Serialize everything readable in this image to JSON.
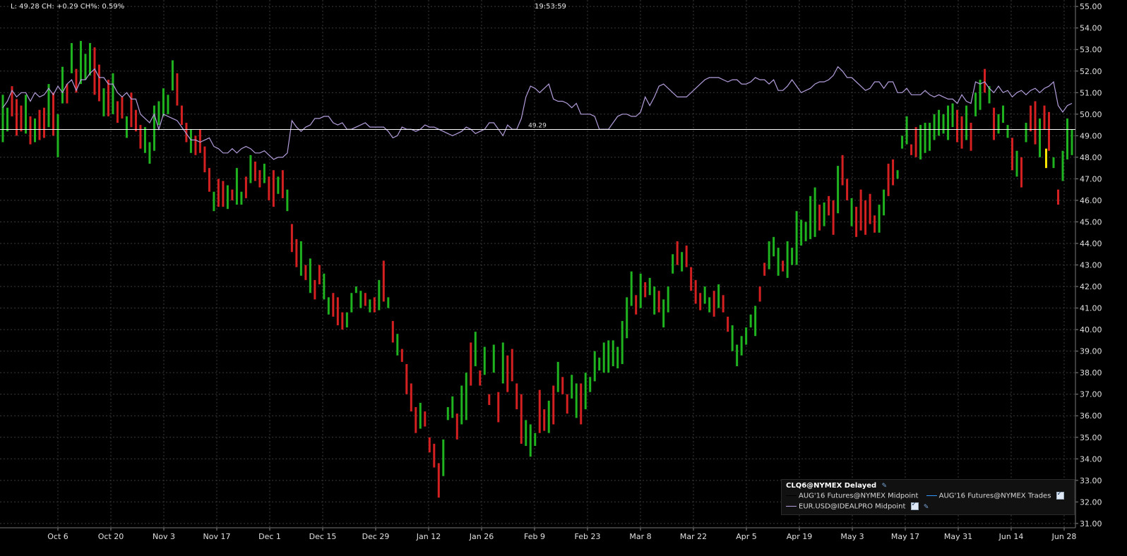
{
  "header": {
    "stats": "L: 49.28 CH: +0.29 CH%: 0.59%",
    "time": "19:53:59"
  },
  "legend": {
    "title": "CLQ6@NYMEX Delayed",
    "items": [
      {
        "label": "AUG'16 Futures@NYMEX Midpoint",
        "color": "#000000"
      },
      {
        "label": "AUG'16 Futures@NYMEX Trades",
        "color": "#3399ff"
      },
      {
        "label": "EUR.USD@IDEALPRO Midpoint",
        "color": "#b39ddb"
      }
    ]
  },
  "chart_data": {
    "type": "bar",
    "ylim": [
      30.8,
      55.3
    ],
    "yticks": [
      "31.00",
      "32.00",
      "33.00",
      "34.00",
      "35.00",
      "36.00",
      "37.00",
      "38.00",
      "39.00",
      "40.00",
      "41.00",
      "42.00",
      "43.00",
      "44.00",
      "45.00",
      "46.00",
      "47.00",
      "48.00",
      "49.00",
      "50.00",
      "51.00",
      "52.00",
      "53.00",
      "54.00",
      "55.00"
    ],
    "xticks": [
      "Oct 6",
      "Oct 20",
      "Nov 3",
      "Nov 17",
      "Dec 1",
      "Dec 15",
      "Dec 29",
      "Jan 12",
      "Jan 26",
      "Feb 9",
      "Feb 23",
      "Mar 8",
      "Mar 22",
      "Apr 5",
      "Apr 19",
      "May 3",
      "May 17",
      "May 31",
      "Jun 14",
      "Jun 28"
    ],
    "last_price_line": {
      "value": 49.29,
      "label": "49.29",
      "color": "#ffffff"
    },
    "colors": {
      "up": "#1fb31f",
      "down": "#d42020",
      "current": "#ffe400",
      "eurusd": "#b39ddb",
      "grid": "#3a3a3a"
    },
    "ohlc_bars": [
      [
        50.9,
        48.7
      ],
      [
        50.3,
        49.2
      ],
      [
        51.3,
        49.9
      ],
      [
        50.7,
        49.0
      ],
      [
        50.4,
        49.2
      ],
      [
        50.9,
        49.1
      ],
      [
        49.9,
        48.6
      ],
      [
        49.8,
        48.7
      ],
      [
        50.2,
        48.8
      ],
      [
        50.3,
        48.9
      ],
      [
        51.4,
        49.4
      ],
      [
        51.0,
        49.0
      ],
      [
        50.0,
        48.0
      ],
      [
        52.2,
        50.5
      ],
      [
        51.4,
        50.5
      ],
      [
        53.3,
        51.9
      ],
      [
        52.1,
        51.0
      ],
      [
        53.4,
        51.4
      ],
      [
        52.8,
        51.6
      ],
      [
        53.3,
        51.8
      ],
      [
        53.1,
        50.9
      ],
      [
        52.3,
        50.6
      ],
      [
        51.2,
        49.9
      ],
      [
        51.6,
        49.9
      ],
      [
        51.9,
        50.0
      ],
      [
        50.6,
        49.6
      ],
      [
        50.8,
        49.8
      ],
      [
        49.9,
        48.9
      ],
      [
        51.0,
        49.4
      ],
      [
        50.2,
        49.2
      ],
      [
        49.5,
        48.4
      ],
      [
        49.4,
        48.2
      ],
      [
        48.7,
        47.7
      ],
      [
        50.4,
        48.3
      ],
      [
        50.6,
        49.5
      ],
      [
        51.2,
        49.9
      ],
      [
        50.9,
        50.0
      ],
      [
        52.5,
        51.1
      ],
      [
        51.9,
        50.4
      ],
      [
        50.4,
        49.5
      ],
      [
        49.6,
        48.7
      ],
      [
        49.3,
        48.2
      ],
      [
        49.0,
        48.1
      ],
      [
        49.3,
        48.2
      ],
      [
        48.5,
        47.3
      ],
      [
        47.5,
        46.4
      ],
      [
        46.4,
        45.5
      ],
      [
        47.0,
        45.7
      ],
      [
        46.9,
        45.7
      ],
      [
        46.7,
        45.6
      ],
      [
        46.5,
        46.0
      ],
      [
        47.5,
        45.8
      ],
      [
        46.4,
        45.8
      ],
      [
        47.1,
        46.1
      ],
      [
        48.1,
        46.8
      ],
      [
        47.8,
        46.9
      ],
      [
        47.4,
        46.6
      ],
      [
        47.7,
        46.8
      ],
      [
        47.1,
        46.0
      ],
      [
        47.4,
        45.7
      ],
      [
        47.1,
        46.3
      ],
      [
        47.4,
        46.1
      ],
      [
        46.5,
        45.5
      ],
      [
        44.9,
        43.6
      ],
      [
        44.2,
        42.9
      ],
      [
        44.1,
        42.5
      ],
      [
        43.0,
        42.3
      ],
      [
        43.3,
        41.7
      ],
      [
        42.3,
        41.4
      ],
      [
        43.0,
        42.1
      ],
      [
        42.6,
        41.4
      ],
      [
        41.5,
        40.7
      ],
      [
        41.7,
        40.6
      ],
      [
        41.5,
        40.2
      ],
      [
        40.8,
        40.0
      ],
      [
        40.8,
        40.1
      ],
      [
        41.7,
        40.8
      ],
      [
        42.0,
        41.7
      ],
      [
        41.8,
        41.0
      ],
      [
        41.7,
        41.1
      ],
      [
        41.4,
        40.8
      ],
      [
        41.5,
        40.8
      ],
      [
        42.3,
        40.9
      ],
      [
        43.2,
        41.3
      ],
      [
        41.5,
        41.0
      ],
      [
        40.4,
        39.4
      ],
      [
        39.8,
        38.8
      ],
      [
        39.1,
        38.5
      ],
      [
        38.4,
        37.0
      ],
      [
        37.5,
        36.2
      ],
      [
        36.4,
        35.2
      ],
      [
        36.6,
        35.4
      ],
      [
        36.2,
        35.5
      ],
      [
        35.0,
        34.3
      ],
      [
        34.7,
        33.6
      ],
      [
        33.8,
        32.2
      ],
      [
        34.9,
        33.2
      ],
      [
        36.4,
        35.8
      ],
      [
        36.9,
        35.9
      ],
      [
        36.1,
        34.9
      ],
      [
        37.4,
        35.6
      ],
      [
        38.0,
        35.8
      ],
      [
        39.4,
        37.4
      ],
      [
        39.9,
        38.3
      ],
      [
        38.1,
        37.4
      ],
      [
        39.2,
        37.9
      ],
      [
        37.0,
        36.5
      ],
      [
        39.3,
        38.0
      ],
      [
        37.1,
        35.7
      ],
      [
        39.4,
        37.5
      ],
      [
        38.8,
        37.1
      ],
      [
        39.1,
        37.6
      ],
      [
        37.5,
        36.3
      ],
      [
        37.0,
        34.7
      ],
      [
        35.8,
        34.6
      ],
      [
        35.6,
        34.1
      ],
      [
        35.2,
        34.6
      ],
      [
        37.2,
        35.2
      ],
      [
        36.3,
        35.3
      ],
      [
        36.7,
        35.2
      ],
      [
        37.4,
        35.6
      ],
      [
        38.5,
        37.1
      ],
      [
        37.8,
        37.0
      ],
      [
        37.0,
        36.1
      ],
      [
        37.9,
        36.8
      ],
      [
        37.5,
        35.9
      ],
      [
        37.5,
        35.6
      ],
      [
        38.0,
        36.3
      ],
      [
        37.8,
        37.1
      ],
      [
        39.0,
        37.6
      ],
      [
        38.7,
        38.1
      ],
      [
        39.4,
        38.0
      ],
      [
        39.5,
        38.0
      ],
      [
        39.5,
        38.3
      ],
      [
        39.2,
        38.2
      ],
      [
        40.4,
        38.4
      ],
      [
        41.5,
        39.6
      ],
      [
        42.7,
        41.1
      ],
      [
        41.6,
        40.7
      ],
      [
        42.6,
        41.0
      ],
      [
        42.2,
        41.5
      ],
      [
        42.4,
        41.6
      ],
      [
        42.0,
        40.7
      ],
      [
        41.8,
        40.8
      ],
      [
        41.4,
        40.1
      ],
      [
        42.0,
        40.8
      ],
      [
        43.5,
        42.6
      ],
      [
        44.1,
        43.0
      ],
      [
        43.6,
        42.7
      ],
      [
        43.9,
        42.9
      ],
      [
        42.9,
        41.8
      ],
      [
        42.3,
        41.2
      ],
      [
        41.7,
        40.9
      ],
      [
        42.0,
        41.2
      ],
      [
        41.5,
        40.8
      ],
      [
        41.8,
        40.6
      ],
      [
        42.1,
        41.0
      ],
      [
        41.6,
        40.8
      ],
      [
        40.6,
        39.9
      ],
      [
        40.2,
        39.0
      ],
      [
        39.3,
        38.3
      ],
      [
        39.7,
        38.8
      ],
      [
        40.1,
        39.3
      ],
      [
        40.7,
        40.1
      ],
      [
        41.1,
        39.7
      ],
      [
        42.0,
        41.3
      ],
      [
        43.1,
        42.5
      ],
      [
        44.1,
        42.8
      ],
      [
        44.3,
        43.4
      ],
      [
        43.8,
        42.5
      ],
      [
        43.2,
        42.7
      ],
      [
        44.1,
        42.4
      ],
      [
        43.8,
        43.0
      ],
      [
        45.5,
        43.0
      ],
      [
        45.1,
        43.9
      ],
      [
        45.0,
        44.1
      ],
      [
        46.2,
        44.2
      ],
      [
        46.6,
        44.3
      ],
      [
        45.8,
        44.6
      ],
      [
        45.9,
        44.8
      ],
      [
        46.2,
        45.3
      ],
      [
        46.0,
        44.4
      ],
      [
        47.6,
        45.4
      ],
      [
        48.1,
        46.7
      ],
      [
        47.0,
        46.0
      ],
      [
        46.1,
        44.8
      ],
      [
        45.7,
        44.3
      ],
      [
        46.5,
        44.6
      ],
      [
        46.0,
        44.4
      ],
      [
        46.3,
        44.9
      ],
      [
        45.3,
        44.5
      ],
      [
        45.8,
        44.5
      ],
      [
        46.5,
        45.3
      ],
      [
        47.7,
        46.2
      ],
      [
        47.9,
        46.7
      ],
      [
        47.4,
        47.0
      ],
      [
        49.0,
        48.4
      ],
      [
        49.9,
        48.6
      ],
      [
        48.6,
        48.1
      ],
      [
        49.4,
        48.0
      ],
      [
        49.5,
        47.9
      ],
      [
        49.6,
        48.2
      ],
      [
        49.6,
        48.3
      ],
      [
        50.0,
        48.8
      ],
      [
        50.2,
        49.0
      ],
      [
        50.0,
        49.1
      ],
      [
        50.4,
        48.8
      ],
      [
        50.5,
        49.4
      ],
      [
        50.2,
        48.7
      ],
      [
        49.9,
        48.4
      ],
      [
        50.4,
        48.8
      ],
      [
        49.6,
        48.3
      ],
      [
        51.0,
        49.9
      ],
      [
        51.6,
        50.2
      ],
      [
        52.1,
        51.0
      ],
      [
        51.3,
        50.5
      ],
      [
        50.3,
        48.8
      ],
      [
        50.0,
        49.1
      ],
      [
        50.4,
        49.6
      ],
      [
        49.5,
        48.9
      ],
      [
        48.9,
        47.4
      ],
      [
        48.3,
        47.1
      ],
      [
        48.0,
        46.6
      ],
      [
        49.6,
        48.7
      ],
      [
        50.4,
        49.2
      ],
      [
        50.6,
        48.6
      ],
      [
        49.8,
        48.0
      ],
      [
        50.4,
        49.3
      ],
      [
        50.1,
        48.3
      ],
      [
        48.0,
        47.5
      ],
      [
        46.5,
        45.8
      ],
      [
        48.3,
        46.9
      ],
      [
        49.8,
        47.9
      ],
      [
        49.3,
        48.1
      ]
    ],
    "bar_colors": [
      "g",
      "g",
      "r",
      "r",
      "r",
      "g",
      "r",
      "g",
      "r",
      "r",
      "g",
      "r",
      "g",
      "g",
      "r",
      "g",
      "r",
      "g",
      "g",
      "g",
      "r",
      "r",
      "g",
      "r",
      "g",
      "r",
      "r",
      "g",
      "r",
      "r",
      "r",
      "g",
      "g",
      "g",
      "g",
      "g",
      "g",
      "g",
      "r",
      "r",
      "r",
      "g",
      "r",
      "r",
      "r",
      "r",
      "g",
      "r",
      "r",
      "g",
      "r",
      "g",
      "g",
      "r",
      "g",
      "r",
      "r",
      "g",
      "r",
      "r",
      "g",
      "r",
      "g",
      "r",
      "r",
      "g",
      "r",
      "g",
      "r",
      "r",
      "g",
      "g",
      "r",
      "r",
      "r",
      "g",
      "g",
      "g",
      "g",
      "r",
      "g",
      "r",
      "g",
      "r",
      "g",
      "r",
      "g",
      "r",
      "r",
      "r",
      "r",
      "g",
      "r",
      "r",
      "r",
      "r",
      "g",
      "g",
      "g",
      "r",
      "g",
      "g",
      "r",
      "g",
      "r",
      "g",
      "r",
      "g",
      "r",
      "g",
      "r",
      "r",
      "r",
      "r",
      "g",
      "g",
      "g",
      "r",
      "r",
      "g",
      "r",
      "g",
      "r",
      "r",
      "g",
      "g",
      "r",
      "g",
      "g",
      "g",
      "g",
      "g",
      "g",
      "g",
      "g",
      "g",
      "g",
      "g",
      "r",
      "g",
      "r",
      "g",
      "g",
      "r",
      "g",
      "g",
      "g",
      "r",
      "g",
      "r",
      "r",
      "r",
      "r",
      "g",
      "g",
      "r",
      "g",
      "r",
      "r",
      "g",
      "g",
      "g",
      "g",
      "g",
      "g",
      "r",
      "r",
      "g",
      "g",
      "g",
      "r",
      "g",
      "g",
      "g",
      "g",
      "g",
      "g",
      "g",
      "r",
      "g",
      "r",
      "r",
      "g",
      "r",
      "r",
      "g",
      "r",
      "r",
      "r",
      "r",
      "r",
      "g",
      "g",
      "r",
      "r",
      "g",
      "g",
      "g",
      "r",
      "r",
      "g",
      "g",
      "g",
      "g",
      "g",
      "g",
      "g",
      "g",
      "r",
      "r",
      "g",
      "r",
      "g",
      "g",
      "r",
      "g",
      "r",
      "g",
      "g",
      "g",
      "r",
      "g",
      "r",
      "g",
      "r",
      "r",
      "g",
      "r",
      "r",
      "g",
      "r",
      "g",
      "g",
      "g"
    ],
    "eurusd_line": [
      50.3,
      50.6,
      51.1,
      50.8,
      51.0,
      51.0,
      50.6,
      51.0,
      50.8,
      50.9,
      51.2,
      50.9,
      51.3,
      51.0,
      51.4,
      51.6,
      51.1,
      51.6,
      51.6,
      51.9,
      52.1,
      51.7,
      51.7,
      51.4,
      51.4,
      51.0,
      50.8,
      51.0,
      50.7,
      50.7,
      50.0,
      49.8,
      49.6,
      50.0,
      49.3,
      50.0,
      49.9,
      49.8,
      49.7,
      49.4,
      49.1,
      48.8,
      48.8,
      48.7,
      48.8,
      48.9,
      48.5,
      48.4,
      48.2,
      48.2,
      48.4,
      48.2,
      48.4,
      48.5,
      48.4,
      48.2,
      48.2,
      48.3,
      48.1,
      47.9,
      48.0,
      48.0,
      48.2,
      49.7,
      49.4,
      49.2,
      49.4,
      49.5,
      49.8,
      49.8,
      49.9,
      49.9,
      49.6,
      49.5,
      49.6,
      49.3,
      49.3,
      49.4,
      49.5,
      49.6,
      49.4,
      49.4,
      49.4,
      49.4,
      49.2,
      48.9,
      49.0,
      49.4,
      49.3,
      49.3,
      49.2,
      49.3,
      49.5,
      49.4,
      49.4,
      49.3,
      49.2,
      49.1,
      49.0,
      49.1,
      49.2,
      49.4,
      49.3,
      49.1,
      49.2,
      49.3,
      49.6,
      49.6,
      49.3,
      49.0,
      49.5,
      49.3,
      49.3,
      49.8,
      50.8,
      51.3,
      51.2,
      51.0,
      51.2,
      51.4,
      50.7,
      50.6,
      50.6,
      50.5,
      50.3,
      50.5,
      50.0,
      50.0,
      50.0,
      49.9,
      49.3,
      49.3,
      49.3,
      49.6,
      49.9,
      50.0,
      50.0,
      49.9,
      49.9,
      50.1,
      50.8,
      50.4,
      50.8,
      51.3,
      51.4,
      51.2,
      51.0,
      50.8,
      50.8,
      50.8,
      51.0,
      51.2,
      51.4,
      51.6,
      51.7,
      51.7,
      51.7,
      51.6,
      51.5,
      51.6,
      51.6,
      51.4,
      51.4,
      51.5,
      51.7,
      51.6,
      51.6,
      51.4,
      51.6,
      51.1,
      51.1,
      51.3,
      51.6,
      51.3,
      51.0,
      51.1,
      51.2,
      51.4,
      51.5,
      51.5,
      51.6,
      51.8,
      52.2,
      52.0,
      51.7,
      51.7,
      51.5,
      51.3,
      51.1,
      51.2,
      51.5,
      51.5,
      51.2,
      51.5,
      51.5,
      51.0,
      51.0,
      51.2,
      50.9,
      50.9,
      50.9,
      51.1,
      50.9,
      50.8,
      50.9,
      50.8,
      50.7,
      50.7,
      50.5,
      50.9,
      50.6,
      50.5,
      51.5,
      51.4,
      51.5,
      51.2,
      51.0,
      51.3,
      51.0,
      51.1,
      50.8,
      51.0,
      51.1,
      50.9,
      51.1,
      51.2,
      51.0,
      51.2,
      51.3,
      51.5,
      50.4,
      50.1,
      50.4,
      50.5
    ],
    "current_bar": {
      "value_high": 48.4,
      "value_low": 47.5
    }
  }
}
